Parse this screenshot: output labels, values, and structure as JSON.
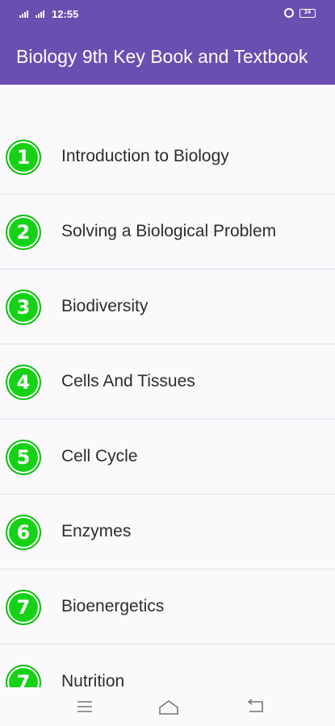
{
  "status_bar": {
    "time": "12:55",
    "battery": "24"
  },
  "app_bar": {
    "title": "Biology 9th Key Book and Textbook"
  },
  "chapters": [
    {
      "number": "1",
      "title": "Introduction to Biology"
    },
    {
      "number": "2",
      "title": "Solving a Biological Problem"
    },
    {
      "number": "3",
      "title": "Biodiversity"
    },
    {
      "number": "4",
      "title": "Cells And Tissues"
    },
    {
      "number": "5",
      "title": "Cell Cycle"
    },
    {
      "number": "6",
      "title": "Enzymes"
    },
    {
      "number": "7",
      "title": "Bioenergetics"
    },
    {
      "number": "7",
      "title": "Nutrition"
    }
  ],
  "nav_bar": {
    "icons": [
      "menu-icon",
      "home-icon",
      "back-icon"
    ]
  },
  "colors": {
    "app_bar": "#6a4fb1",
    "badge": "#16d216",
    "background": "#fbf9fc"
  }
}
